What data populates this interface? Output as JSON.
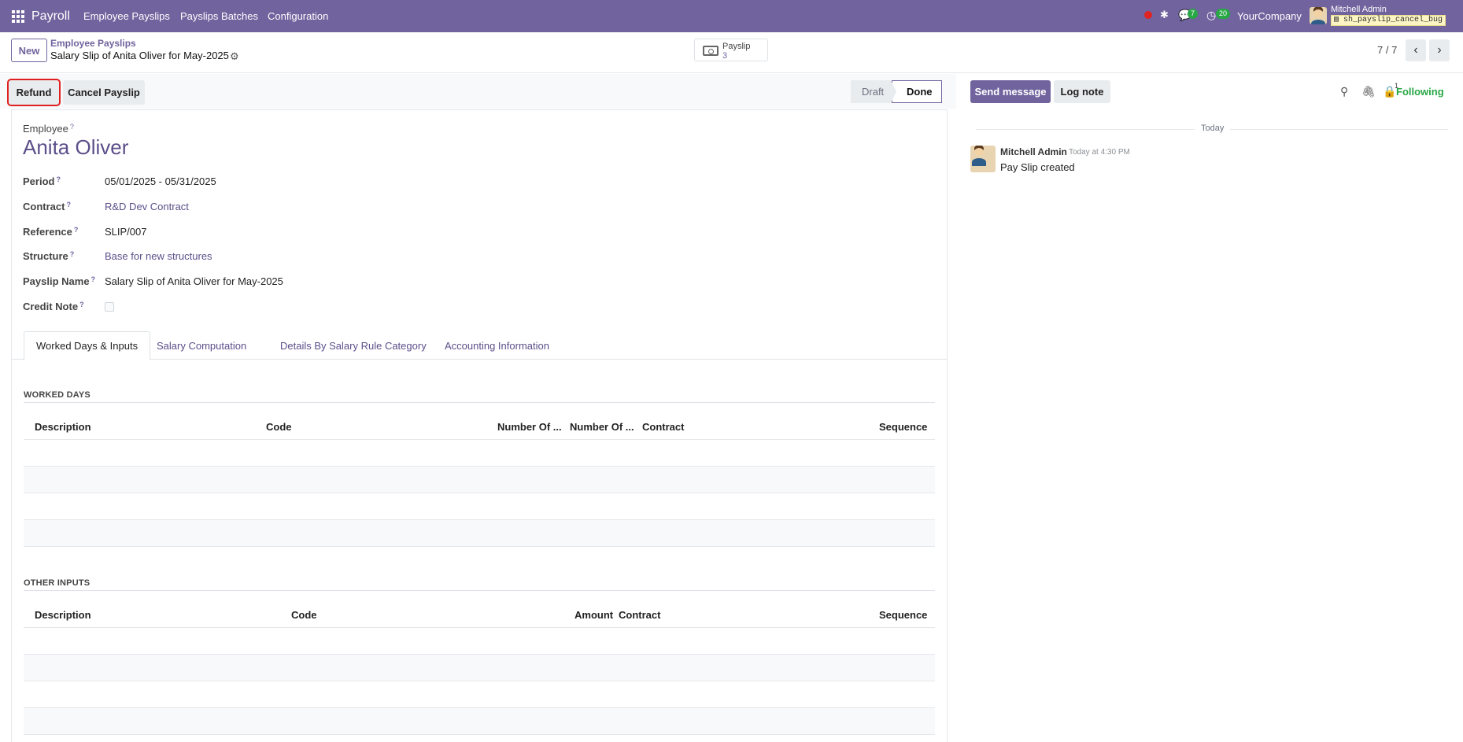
{
  "nav": {
    "app": "Payroll",
    "menu": [
      "Employee Payslips",
      "Payslips Batches",
      "Configuration"
    ],
    "chat_badge": "7",
    "activity_badge": "20",
    "company": "YourCompany",
    "user": "Mitchell Admin",
    "db": "sh_payslip_cancel_bug"
  },
  "control": {
    "new_label": "New",
    "breadcrumb_parent": "Employee Payslips",
    "breadcrumb_current": "Salary Slip of Anita Oliver for May-2025",
    "smart_label": "Payslip",
    "smart_count": "3",
    "pager": "7 / 7"
  },
  "actions": {
    "refund": "Refund",
    "cancel": "Cancel Payslip",
    "status": [
      "Draft",
      "Done"
    ],
    "status_current": "Done"
  },
  "form": {
    "employee_label": "Employee",
    "employee_name": "Anita Oliver",
    "fields": [
      {
        "label": "Period",
        "value": "05/01/2025 - 05/31/2025"
      },
      {
        "label": "Contract",
        "value": "R&D Dev Contract"
      },
      {
        "label": "Reference",
        "value": "SLIP/007"
      },
      {
        "label": "Structure",
        "value": "Base for new structures"
      },
      {
        "label": "Payslip Name",
        "value": "Salary Slip of Anita Oliver for May-2025"
      },
      {
        "label": "Credit Note",
        "value": ""
      }
    ],
    "help_mark": "?"
  },
  "tabs": [
    "Worked Days & Inputs",
    "Salary Computation",
    "Details By Salary Rule Category",
    "Accounting Information"
  ],
  "worked_days": {
    "title": "WORKED DAYS",
    "columns": [
      "Description",
      "Code",
      "Number Of ...",
      "Number Of ...",
      "Contract",
      "Sequence"
    ]
  },
  "other_inputs": {
    "title": "OTHER INPUTS",
    "columns": [
      "Description",
      "Code",
      "Amount",
      "Contract",
      "Sequence"
    ]
  },
  "chatter": {
    "send": "Send message",
    "log": "Log note",
    "followers_count": "1",
    "following": "Following",
    "date_sep": "Today",
    "author": "Mitchell Admin",
    "time": "Today at 4:30 PM",
    "body": "Pay Slip created"
  }
}
